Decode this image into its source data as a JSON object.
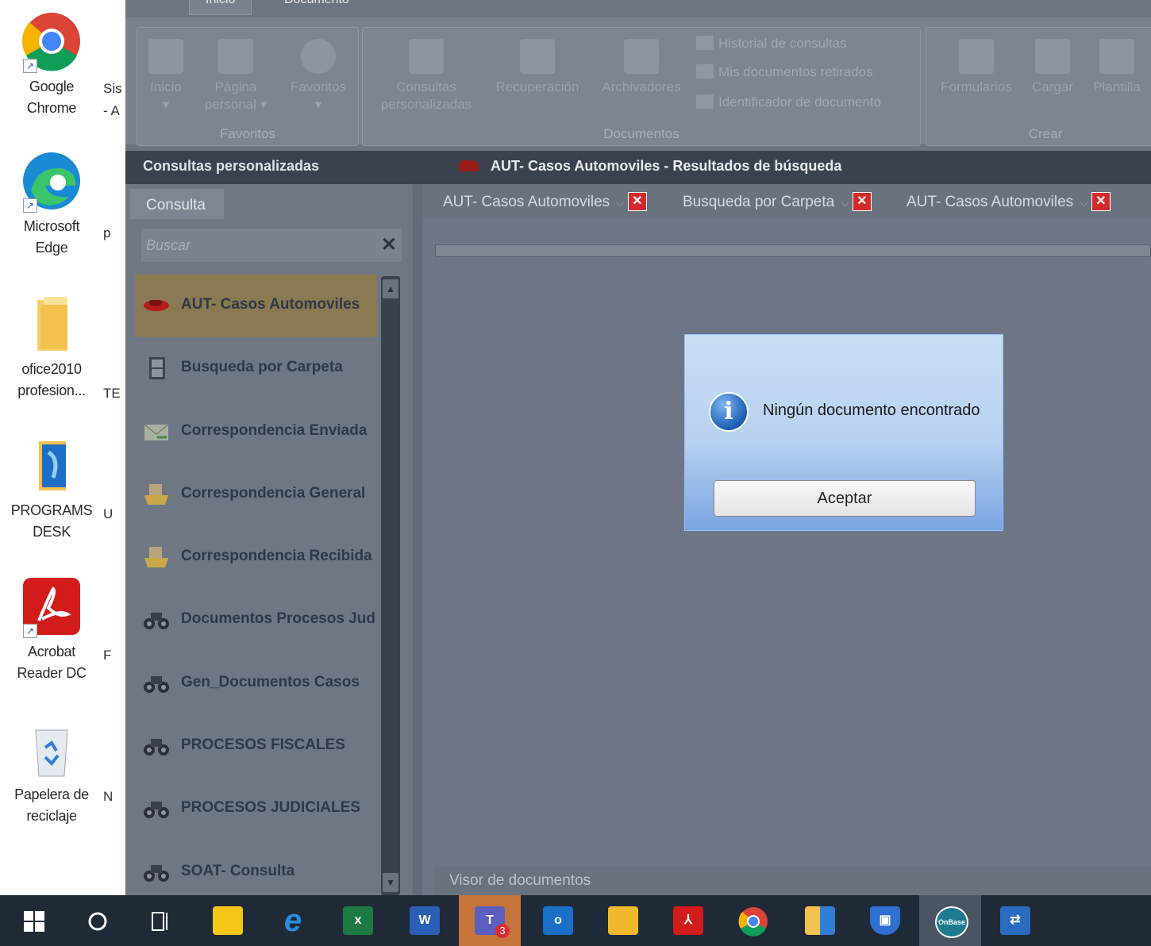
{
  "desktop": {
    "icons": [
      {
        "label": "Google Chrome",
        "icon": "chrome-icon"
      },
      {
        "label": "Microsoft Edge",
        "icon": "edge-icon"
      },
      {
        "label": "ofice2010 profesion...",
        "icon": "folder-icon"
      },
      {
        "label": "PROGRAMS DESK",
        "icon": "programs-folder-icon"
      },
      {
        "label": "Acrobat Reader DC",
        "icon": "acrobat-icon"
      },
      {
        "label": "Papelera de reciclaje",
        "icon": "recycle-bin-icon"
      }
    ],
    "partial_labels": [
      "Sis",
      "- A",
      "p",
      "TE",
      "U",
      "F",
      "N"
    ]
  },
  "ribbon": {
    "tabs": [
      "Inicio",
      "Documento"
    ],
    "groups": {
      "favoritos": {
        "name": "Favoritos",
        "buttons": [
          "Inicio",
          "Página personal",
          "Favoritos"
        ]
      },
      "documentos": {
        "name": "Documentos",
        "buttons": [
          "Consultas personalizadas",
          "Recuperación",
          "Archivadores"
        ],
        "small": [
          "Historial de consultas",
          "Mis documentos retirados",
          "Identificador de documento"
        ]
      },
      "crear": {
        "name": "Crear",
        "buttons": [
          "Formularios",
          "Cargar",
          "Plantilla"
        ]
      }
    }
  },
  "left_panel": {
    "title": "Consultas personalizadas",
    "tab": "Consulta",
    "search_placeholder": "Buscar",
    "queries": [
      {
        "label": "AUT- Casos Automoviles",
        "icon": "car-icon",
        "selected": true
      },
      {
        "label": "Busqueda por Carpeta",
        "icon": "cabinet-icon"
      },
      {
        "label": "Correspondencia Enviada",
        "icon": "envelope-icon"
      },
      {
        "label": "Correspondencia General",
        "icon": "mail-tray-icon"
      },
      {
        "label": "Correspondencia Recibida",
        "icon": "mail-tray-icon"
      },
      {
        "label": "Documentos Procesos Judiciales",
        "icon": "binoculars-icon"
      },
      {
        "label": "Gen_Documentos Casos",
        "icon": "binoculars-icon"
      },
      {
        "label": "PROCESOS FISCALES",
        "icon": "binoculars-icon"
      },
      {
        "label": "PROCESOS JUDICIALES",
        "icon": "binoculars-icon"
      },
      {
        "label": "SOAT- Consulta",
        "icon": "binoculars-icon"
      }
    ]
  },
  "results": {
    "title": "AUT- Casos Automoviles - Resultados de búsqueda",
    "tabs": [
      "AUT- Casos Automoviles",
      "Busqueda por Carpeta",
      "AUT- Casos Automoviles"
    ],
    "visor": "Visor de documentos"
  },
  "dialog": {
    "message": "Ningún documento encontrado",
    "ok_label": "Aceptar"
  },
  "taskbar": {
    "apps": [
      "start",
      "search",
      "task-view",
      "sticky-notes",
      "internet-explorer",
      "excel",
      "word",
      "teams",
      "outlook",
      "file-explorer",
      "acrobat",
      "chrome",
      "files",
      "defender",
      "onbase",
      "remote-desktop"
    ],
    "teams_badge": "3",
    "onbase_label": "OnBase"
  }
}
